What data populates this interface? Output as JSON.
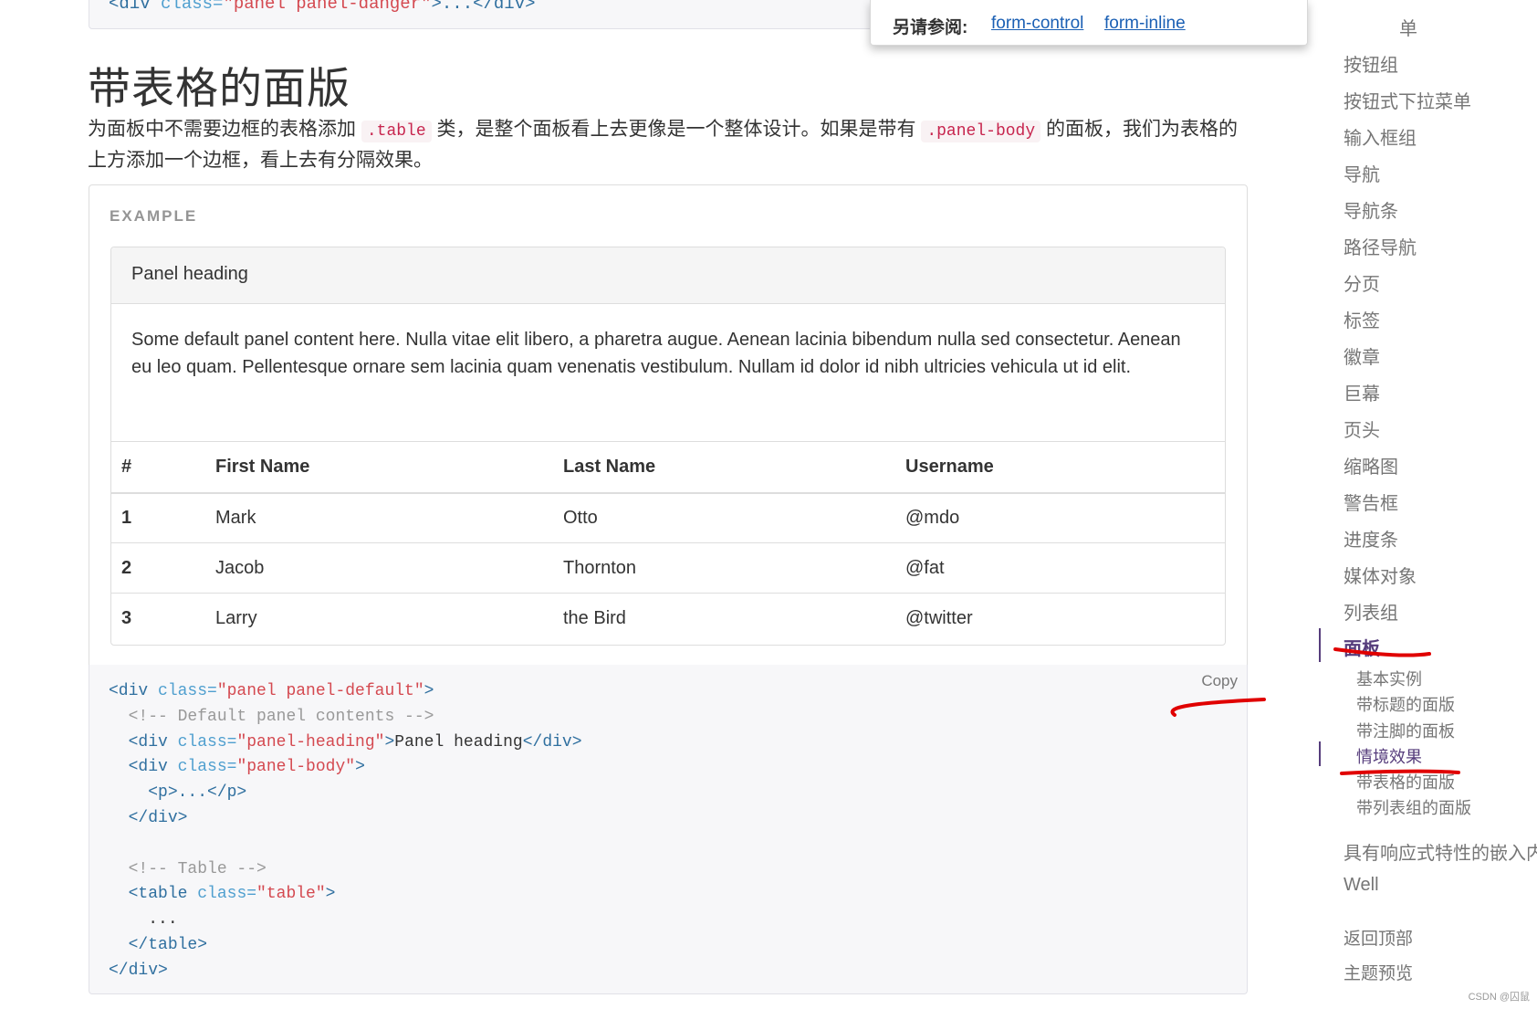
{
  "top_code": {
    "tag_open": "<div ",
    "attr": "class=",
    "value": "\"panel panel-danger\"",
    "rest": ">...</div>"
  },
  "see_also": {
    "label": "另请参阅:",
    "links": [
      "form-control",
      "form-inline"
    ]
  },
  "section": {
    "title": "带表格的面版",
    "desc_part1": "为面板中不需要边框的表格添加 ",
    "code1": ".table",
    "desc_part2": " 类，是整个面板看上去更像是一个整体设计。如果是带有 ",
    "code2": ".panel-body",
    "desc_part3": " 的面板，我们为表格的上方添加一个边框，看上去有分隔效果。"
  },
  "example": {
    "label": "EXAMPLE",
    "panel_heading": "Panel heading",
    "panel_body": "Some default panel content here. Nulla vitae elit libero, a pharetra augue. Aenean lacinia bibendum nulla sed consectetur. Aenean eu leo quam. Pellentesque ornare sem lacinia quam venenatis vestibulum. Nullam id dolor id nibh ultricies vehicula ut id elit.",
    "table": {
      "headers": [
        "#",
        "First Name",
        "Last Name",
        "Username"
      ],
      "rows": [
        [
          "1",
          "Mark",
          "Otto",
          "@mdo"
        ],
        [
          "2",
          "Jacob",
          "Thornton",
          "@fat"
        ],
        [
          "3",
          "Larry",
          "the Bird",
          "@twitter"
        ]
      ]
    }
  },
  "code": {
    "copy_label": "Copy",
    "l1_tag": "<div ",
    "l1_attr": "class=",
    "l1_val": "\"panel panel-default\"",
    "l1_end": ">",
    "l2": "<!-- Default panel contents -->",
    "l3_tag": "<div ",
    "l3_attr": "class=",
    "l3_val": "\"panel-heading\"",
    "l3_mid": ">",
    "l3_txt": "Panel heading",
    "l3_end": "</div>",
    "l4_tag": "<div ",
    "l4_attr": "class=",
    "l4_val": "\"panel-body\"",
    "l4_end": ">",
    "l5": "<p>...</p>",
    "l6": "</div>",
    "l7": "<!-- Table -->",
    "l8_tag": "<table ",
    "l8_attr": "class=",
    "l8_val": "\"table\"",
    "l8_end": ">",
    "l9": "...",
    "l10": "</table>",
    "l11": "</div>"
  },
  "sidebar": {
    "truncated_item": "单",
    "items": [
      "按钮组",
      "按钮式下拉菜单",
      "输入框组",
      "导航",
      "导航条",
      "路径导航",
      "分页",
      "标签",
      "徽章",
      "巨幕",
      "页头",
      "缩略图",
      "警告框",
      "进度条",
      "媒体对象",
      "列表组"
    ],
    "active_item": "面板",
    "sub_items": [
      "基本实例",
      "带标题的面版",
      "带注脚的面板",
      "情境效果",
      "带表格的面版",
      "带列表组的面版"
    ],
    "active_sub_index": 3,
    "after_items": [
      "具有响应式特性的嵌入内",
      "Well"
    ],
    "footer_items": [
      "返回顶部",
      "主题预览"
    ]
  },
  "watermark": "CSDN @囚鼠",
  "colors": {
    "accent": "#563d7c",
    "annotation": "#e00000",
    "link": "#1a5fb4"
  }
}
